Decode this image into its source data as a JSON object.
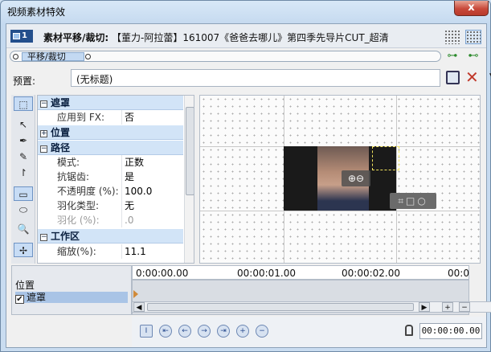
{
  "window": {
    "title": "视频素材特效",
    "close_label": "x"
  },
  "header": {
    "badge": "1",
    "title_bold": "素材平移/裁切:",
    "title_rest": "【董力-阿拉蕾】161007《爸爸去哪儿》第四季先导片CUT_超清"
  },
  "chain": {
    "plugin": "平移/裁切"
  },
  "preset": {
    "label": "预置:",
    "value": "(无标题)"
  },
  "properties": {
    "categories": [
      {
        "name": "遮罩",
        "expanded": true,
        "rows": [
          {
            "label": "应用到 FX:",
            "value": "否"
          }
        ]
      },
      {
        "name": "位置",
        "expanded": false,
        "rows": []
      },
      {
        "name": "路径",
        "expanded": true,
        "rows": [
          {
            "label": "模式:",
            "value": "正数"
          },
          {
            "label": "抗锯齿:",
            "value": "是"
          },
          {
            "label": "不透明度 (%):",
            "value": "100.0"
          },
          {
            "label": "羽化类型:",
            "value": "无"
          },
          {
            "label": "羽化 (%):",
            "value": ".0",
            "disabled": true
          }
        ]
      },
      {
        "name": "工作区",
        "expanded": true,
        "rows": [
          {
            "label": "缩放(%):",
            "value": "11.1"
          }
        ]
      }
    ]
  },
  "preview": {
    "zoom_in": "⊕",
    "zoom_out": "⊖"
  },
  "timeline": {
    "tracks": [
      {
        "label": "位置",
        "checked": false,
        "selected": false
      },
      {
        "label": "遮罩",
        "checked": true,
        "selected": true
      }
    ],
    "ruler": [
      "0:00:00.00",
      "00:00:01.00",
      "00:00:02.00",
      "00:0"
    ],
    "current_time": "00:00:00.00"
  }
}
